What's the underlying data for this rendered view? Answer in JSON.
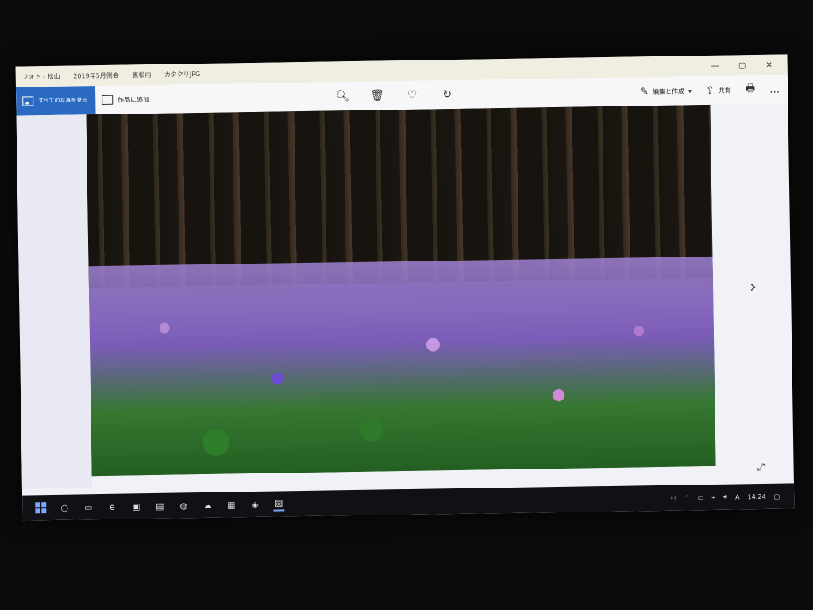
{
  "titlebar": {
    "app": "フォト - 松山",
    "crumb2": "2019年5月例会",
    "crumb3": "裏松内",
    "file": "カタクリJPG"
  },
  "toolbar": {
    "see_all_label": "すべての写真を見る",
    "add_to_creation_label": "作品に追加",
    "edit_create_label": "編集と作成",
    "share_label": "共有"
  },
  "taskbar": {
    "time": "14:24",
    "ime": "A"
  },
  "icons": {
    "zoom": "zoom-icon",
    "delete": "trash-icon",
    "favorite": "heart-icon",
    "rotate": "rotate-icon",
    "edit": "edit-icon",
    "share": "share-icon",
    "print": "print-icon",
    "more": "more-icon"
  }
}
